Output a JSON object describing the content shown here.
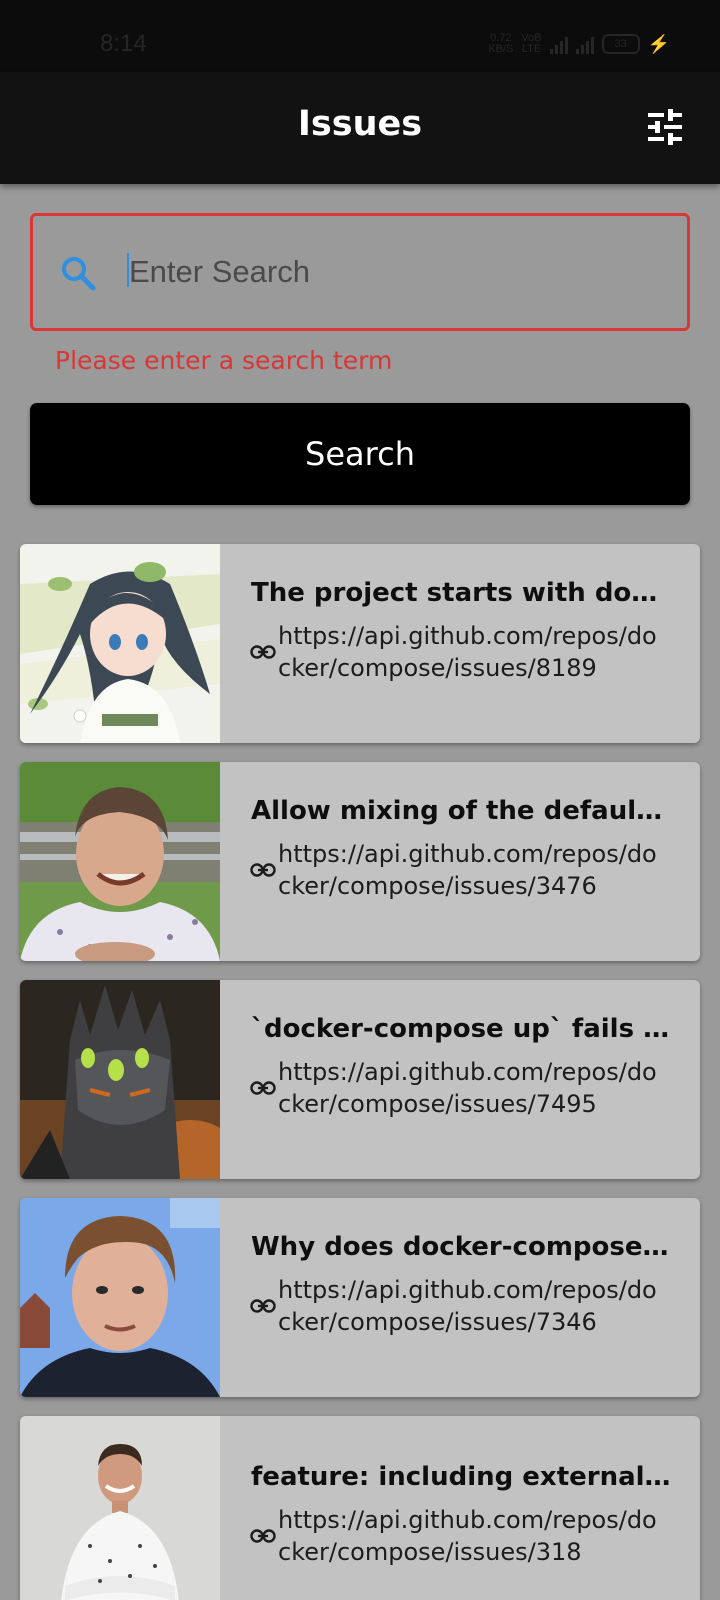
{
  "status_bar": {
    "time": "8:14",
    "net_speed": "0.72",
    "net_unit": "KB/S",
    "net_type_1": "VoB",
    "net_type_2": "LTE",
    "battery": "33"
  },
  "app_bar": {
    "title": "Issues",
    "filter_icon": "tune-icon"
  },
  "search": {
    "placeholder": "Enter Search",
    "value": "",
    "error": "Please enter a search term",
    "button_label": "Search",
    "icon": "search-icon"
  },
  "colors": {
    "error": "#d93636",
    "accent": "#2f8fe0",
    "app_bar": "#121212",
    "background": "#9a9a9a",
    "card": "#c2c2c2"
  },
  "issues": [
    {
      "title": "The project starts with docker-compose",
      "url": "https://api.github.com/repos/docker/compose/issues/8189",
      "avatar": "anime-girl-avatar"
    },
    {
      "title": "Allow mixing of the default ...",
      "url": "https://api.github.com/repos/docker/compose/issues/3476",
      "avatar": "smiling-man-avatar"
    },
    {
      "title": "`docker-compose up` fails in ...",
      "url": "https://api.github.com/repos/docker/compose/issues/7495",
      "avatar": "dark-knight-avatar"
    },
    {
      "title": "Why does docker-compose l...",
      "url": "https://api.github.com/repos/docker/compose/issues/7346",
      "avatar": "man-portrait-avatar"
    },
    {
      "title": "feature: including external ...",
      "url": "https://api.github.com/repos/docker/compose/issues/318",
      "avatar": "man-white-shirt-avatar"
    }
  ]
}
